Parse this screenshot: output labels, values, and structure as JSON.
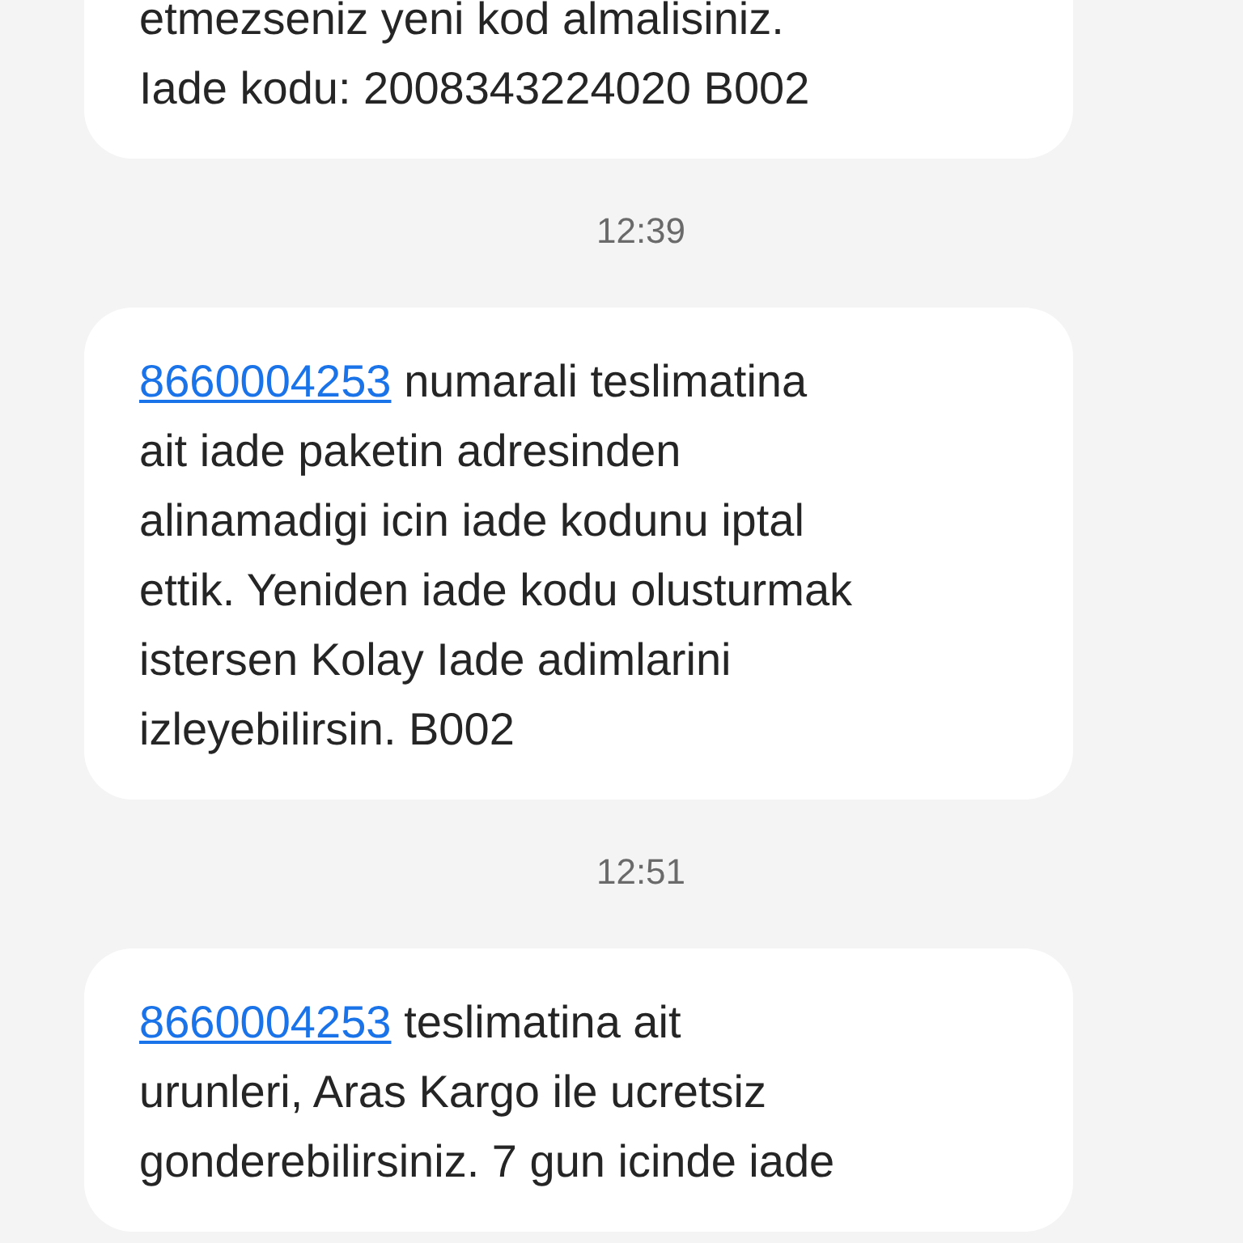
{
  "messages": [
    {
      "lines": [
        "etmezseniz yeni kod almalisiniz.",
        "Iade kodu: 2008343224020 B002"
      ]
    },
    {
      "time": "12:39",
      "link": "8660004253",
      "lines": [
        "numarali teslimatina",
        "ait iade paketin adresinden",
        "alinamadigi icin iade kodunu iptal",
        "ettik. Yeniden iade kodu olusturmak",
        "istersen Kolay Iade adimlarini",
        "izleyebilirsin. B002"
      ]
    },
    {
      "time": "12:51",
      "link": "8660004253",
      "lines": [
        "teslimatina ait",
        "urunleri, Aras Kargo ile ucretsiz",
        "gonderebilirsiniz. 7 gun icinde iade"
      ]
    }
  ]
}
